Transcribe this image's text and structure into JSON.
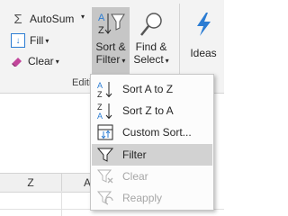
{
  "ribbon": {
    "autosum_label": "AutoSum",
    "fill_label": "Fill",
    "clear_label": "Clear",
    "sort_filter_line1": "Sort &",
    "sort_filter_line2": "Filter",
    "find_select_line1": "Find &",
    "find_select_line2": "Select",
    "ideas_label": "Ideas",
    "group_label": "Editi"
  },
  "menu": {
    "items": [
      {
        "label": "Sort A to Z",
        "icon": "sort-a-to-z-icon",
        "enabled": true
      },
      {
        "label": "Sort Z to A",
        "icon": "sort-z-to-a-icon",
        "enabled": true
      },
      {
        "label": "Custom Sort...",
        "icon": "custom-sort-icon",
        "enabled": true
      },
      {
        "label": "Filter",
        "icon": "filter-icon",
        "enabled": true,
        "highlighted": true
      },
      {
        "label": "Clear",
        "icon": "clear-filter-icon",
        "enabled": false
      },
      {
        "label": "Reapply",
        "icon": "reapply-icon",
        "enabled": false
      }
    ]
  },
  "sheet": {
    "columns": [
      "Z",
      "AA"
    ]
  },
  "colors": {
    "accent_blue": "#2b7cd3",
    "clear_pink": "#c2459b",
    "highlight": "#d2d2d2",
    "disabled_text": "#a6a6a6"
  }
}
